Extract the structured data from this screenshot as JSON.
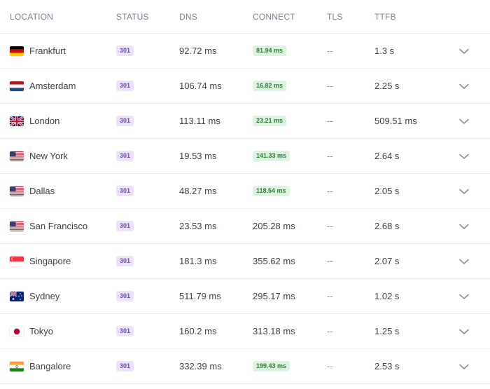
{
  "headers": {
    "location": "LOCATION",
    "status": "STATUS",
    "dns": "DNS",
    "connect": "CONNECT",
    "tls": "TLS",
    "ttfb": "TTFB"
  },
  "colors": {
    "status_badge_bg": "#ece3fa",
    "status_badge_text": "#6d47b8",
    "fast_badge_bg": "#ddf3df",
    "fast_badge_text": "#2f7a39"
  },
  "rows": [
    {
      "location": "Frankfurt",
      "flag": "germany-flag-icon",
      "status": "301",
      "dns": "92.72 ms",
      "connect": "81.94 ms",
      "connect_highlight": true,
      "tls": "--",
      "ttfb": "1.3 s"
    },
    {
      "location": "Amsterdam",
      "flag": "netherlands-flag-icon",
      "status": "301",
      "dns": "106.74 ms",
      "connect": "16.82 ms",
      "connect_highlight": true,
      "tls": "--",
      "ttfb": "2.25 s"
    },
    {
      "location": "London",
      "flag": "uk-flag-icon",
      "status": "301",
      "dns": "113.11 ms",
      "connect": "23.21 ms",
      "connect_highlight": true,
      "tls": "--",
      "ttfb": "509.51 ms"
    },
    {
      "location": "New York",
      "flag": "usa-flag-icon",
      "status": "301",
      "dns": "19.53 ms",
      "connect": "141.33 ms",
      "connect_highlight": true,
      "tls": "--",
      "ttfb": "2.64 s"
    },
    {
      "location": "Dallas",
      "flag": "usa-flag-icon",
      "status": "301",
      "dns": "48.27 ms",
      "connect": "118.54 ms",
      "connect_highlight": true,
      "tls": "--",
      "ttfb": "2.05 s"
    },
    {
      "location": "San Francisco",
      "flag": "usa-flag-icon",
      "status": "301",
      "dns": "23.53 ms",
      "connect": "205.28 ms",
      "connect_highlight": false,
      "tls": "--",
      "ttfb": "2.68 s"
    },
    {
      "location": "Singapore",
      "flag": "singapore-flag-icon",
      "status": "301",
      "dns": "181.3 ms",
      "connect": "355.62 ms",
      "connect_highlight": false,
      "tls": "--",
      "ttfb": "2.07 s"
    },
    {
      "location": "Sydney",
      "flag": "australia-flag-icon",
      "status": "301",
      "dns": "511.79 ms",
      "connect": "295.17 ms",
      "connect_highlight": false,
      "tls": "--",
      "ttfb": "1.02 s"
    },
    {
      "location": "Tokyo",
      "flag": "japan-flag-icon",
      "status": "301",
      "dns": "160.2 ms",
      "connect": "313.18 ms",
      "connect_highlight": false,
      "tls": "--",
      "ttfb": "1.25 s"
    },
    {
      "location": "Bangalore",
      "flag": "india-flag-icon",
      "status": "301",
      "dns": "332.39 ms",
      "connect": "199.43 ms",
      "connect_highlight": true,
      "tls": "--",
      "ttfb": "2.53 s"
    }
  ]
}
